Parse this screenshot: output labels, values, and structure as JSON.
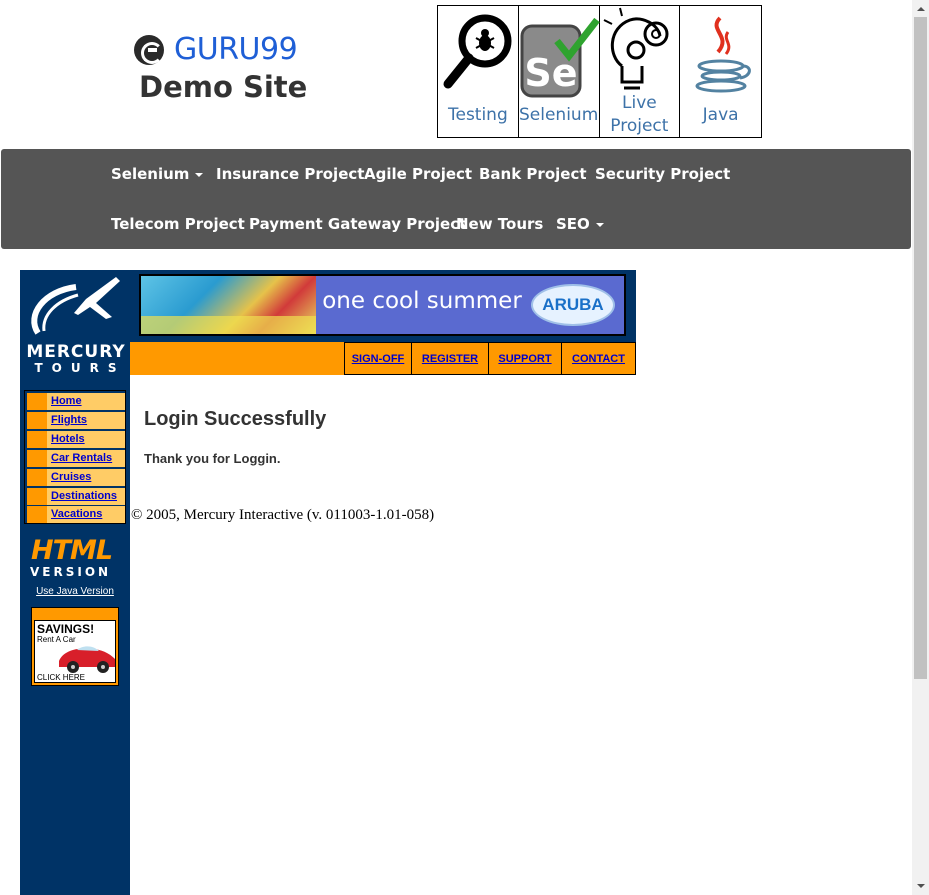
{
  "header": {
    "brand": "GURU99",
    "subtitle": "Demo Site",
    "tiles": [
      {
        "label": "Testing",
        "icon": "magnifier-bug-icon"
      },
      {
        "label": "Selenium",
        "icon": "selenium-se-icon"
      },
      {
        "label_line1": "Live",
        "label_line2": "Project",
        "icon": "lightbulb-gears-icon"
      },
      {
        "label": "Java",
        "icon": "java-cup-icon"
      }
    ]
  },
  "nav": {
    "row1": [
      "Selenium",
      "Insurance Project",
      "Agile Project",
      "Bank Project",
      "Security Project"
    ],
    "row2": [
      "Telecom Project",
      "Payment Gateway Project",
      "New Tours",
      "SEO"
    ]
  },
  "mercury": {
    "brand_line1": "MERCURY",
    "brand_line2": "TOURS",
    "banner": {
      "slogan": "one cool summer",
      "badge": "ARUBA"
    },
    "top_links": [
      "SIGN-OFF",
      "REGISTER",
      "SUPPORT",
      "CONTACT"
    ],
    "menu": [
      "Home",
      "Flights",
      "Hotels",
      "Car Rentals",
      "Cruises",
      "Destinations",
      "Vacations"
    ],
    "html_version": {
      "big": "HTML",
      "sub": "VERSION",
      "link": "Use Java Version"
    },
    "savings": {
      "title": "SAVINGS!",
      "sub": "Rent A Car",
      "cta": "CLICK HERE"
    }
  },
  "content": {
    "title": "Login Successfully",
    "message": "Thank you for Loggin.",
    "copyright": "© 2005, Mercury Interactive (v. 011003-1.01-058)"
  },
  "colors": {
    "navbar": "#555555",
    "mercury_blue": "#003366",
    "mercury_orange": "#ff9900",
    "link": "#0000cc",
    "brand_blue": "#1f5fd6"
  }
}
